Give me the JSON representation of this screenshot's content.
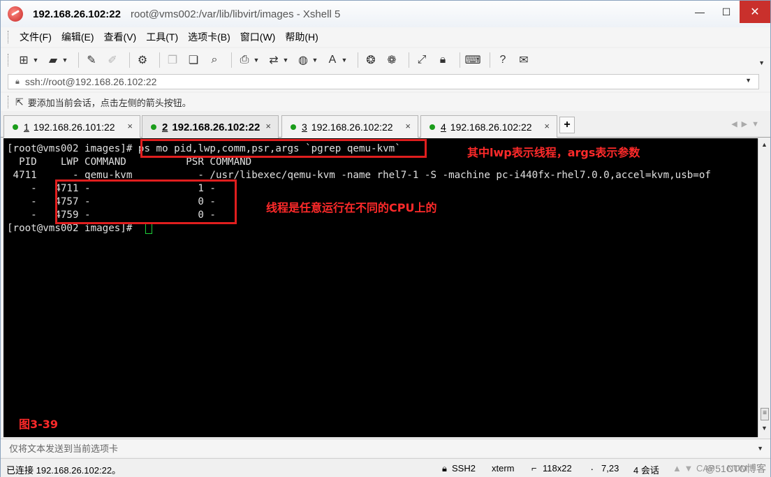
{
  "window": {
    "host": "192.168.26.102:22",
    "path_title": "root@vms002:/var/lib/libvirt/images - Xshell 5",
    "minimize_glyph": "—",
    "maximize_glyph": "☐",
    "close_glyph": "✕"
  },
  "menu": [
    "文件(F)",
    "编辑(E)",
    "查看(V)",
    "工具(T)",
    "选项卡(B)",
    "窗口(W)",
    "帮助(H)"
  ],
  "toolbar_icons": [
    "new-session-icon",
    "open-folder-icon",
    "reconnect-icon",
    "disconnect-icon",
    "properties-icon",
    "copy-icon",
    "paste-icon",
    "find-icon",
    "print-icon",
    "transfer-icon",
    "globe-icon",
    "font-icon",
    "xftp-icon",
    "xmanager-icon",
    "fullscreen-icon",
    "lock-icon",
    "keyboard-icon",
    "help-icon",
    "chat-icon"
  ],
  "address": {
    "value": "ssh://root@192.168.26.102:22"
  },
  "hint": {
    "text": "要添加当前会话，点击左侧的箭头按钮。"
  },
  "tabs": [
    {
      "num": "1",
      "label": "192.168.26.101:22",
      "active": false
    },
    {
      "num": "2",
      "label": "192.168.26.102:22",
      "active": true
    },
    {
      "num": "3",
      "label": "192.168.26.102:22",
      "active": false
    },
    {
      "num": "4",
      "label": "192.168.26.102:22",
      "active": false
    }
  ],
  "terminal": {
    "lines": [
      "[root@vms002 images]# ps mo pid,lwp,comm,psr,args `pgrep qemu-kvm`",
      "  PID    LWP COMMAND          PSR COMMAND",
      " 4711      - qemu-kvm           - /usr/libexec/qemu-kvm -name rhel7-1 -S -machine pc-i440fx-rhel7.0.0,accel=kvm,usb=of",
      "    -   4711 -                  1 -",
      "    -   4757 -                  0 -",
      "    -   4759 -                  0 -",
      "[root@vms002 images]# "
    ],
    "annotations": {
      "lwp_note": "其中lwp表示线程，args表示参数",
      "cpu_note": "线程是任意运行在不同的CPU上的",
      "figure_label": "图3-39"
    }
  },
  "sendbar": {
    "placeholder": "仅将文本发送到当前选项卡"
  },
  "status": {
    "connection": "已连接 192.168.26.102:22。",
    "protocol": "SSH2",
    "term": "xterm",
    "size": "118x22",
    "cursor_pos": "7,23",
    "sessions": "4 会话",
    "caps": "CAP",
    "num": "NUM",
    "watermark": "@51CTO博客"
  }
}
